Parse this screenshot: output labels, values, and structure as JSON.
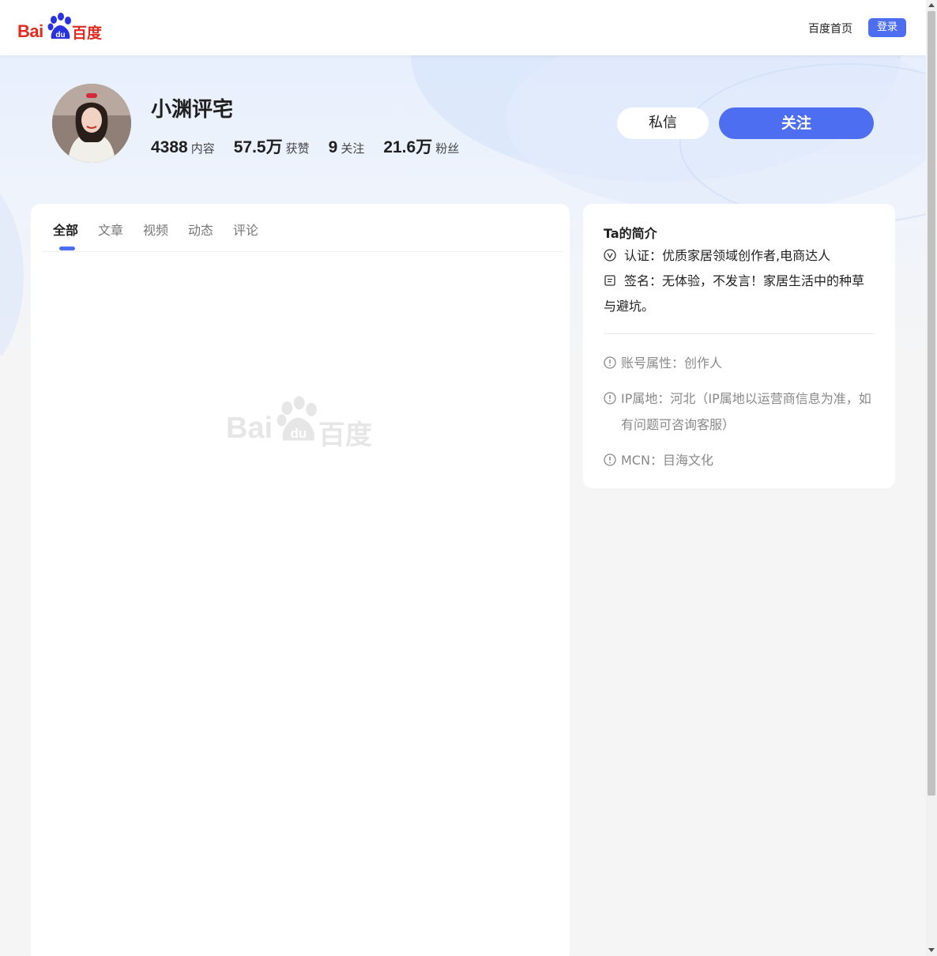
{
  "header": {
    "logo_latin": "Bai",
    "logo_du": "du",
    "logo_cn": "百度",
    "home_link": "百度首页",
    "login_label": "登录"
  },
  "profile": {
    "name": "小渊评宅",
    "stats": [
      {
        "value": "4388",
        "label": "内容"
      },
      {
        "value": "57.5万",
        "label": "获赞"
      },
      {
        "value": "9",
        "label": "关注"
      },
      {
        "value": "21.6万",
        "label": "粉丝"
      }
    ],
    "message_label": "私信",
    "follow_label": "关注"
  },
  "tabs": [
    {
      "label": "全部",
      "active": true
    },
    {
      "label": "文章",
      "active": false
    },
    {
      "label": "视频",
      "active": false
    },
    {
      "label": "动态",
      "active": false
    },
    {
      "label": "评论",
      "active": false
    }
  ],
  "placeholder": {
    "logo_latin": "Bai",
    "logo_du": "du",
    "logo_cn": "百度"
  },
  "intro": {
    "title": "Ta的简介",
    "verification": "认证：优质家居领域创作者,电商达人",
    "signature": "签名：无体验，不发言！家居生活中的种草与避坑。",
    "account_type": "账号属性：创作人",
    "ip_location_1": "IP属地：河北（IP属地以运营商信息为准，如",
    "ip_location_2": "有问题可咨询客服）",
    "mcn": "MCN：目海文化"
  },
  "colors": {
    "brand_red": "#e02b20",
    "accent_blue": "#4e6ef2",
    "page_bg": "#f5f5f5"
  }
}
